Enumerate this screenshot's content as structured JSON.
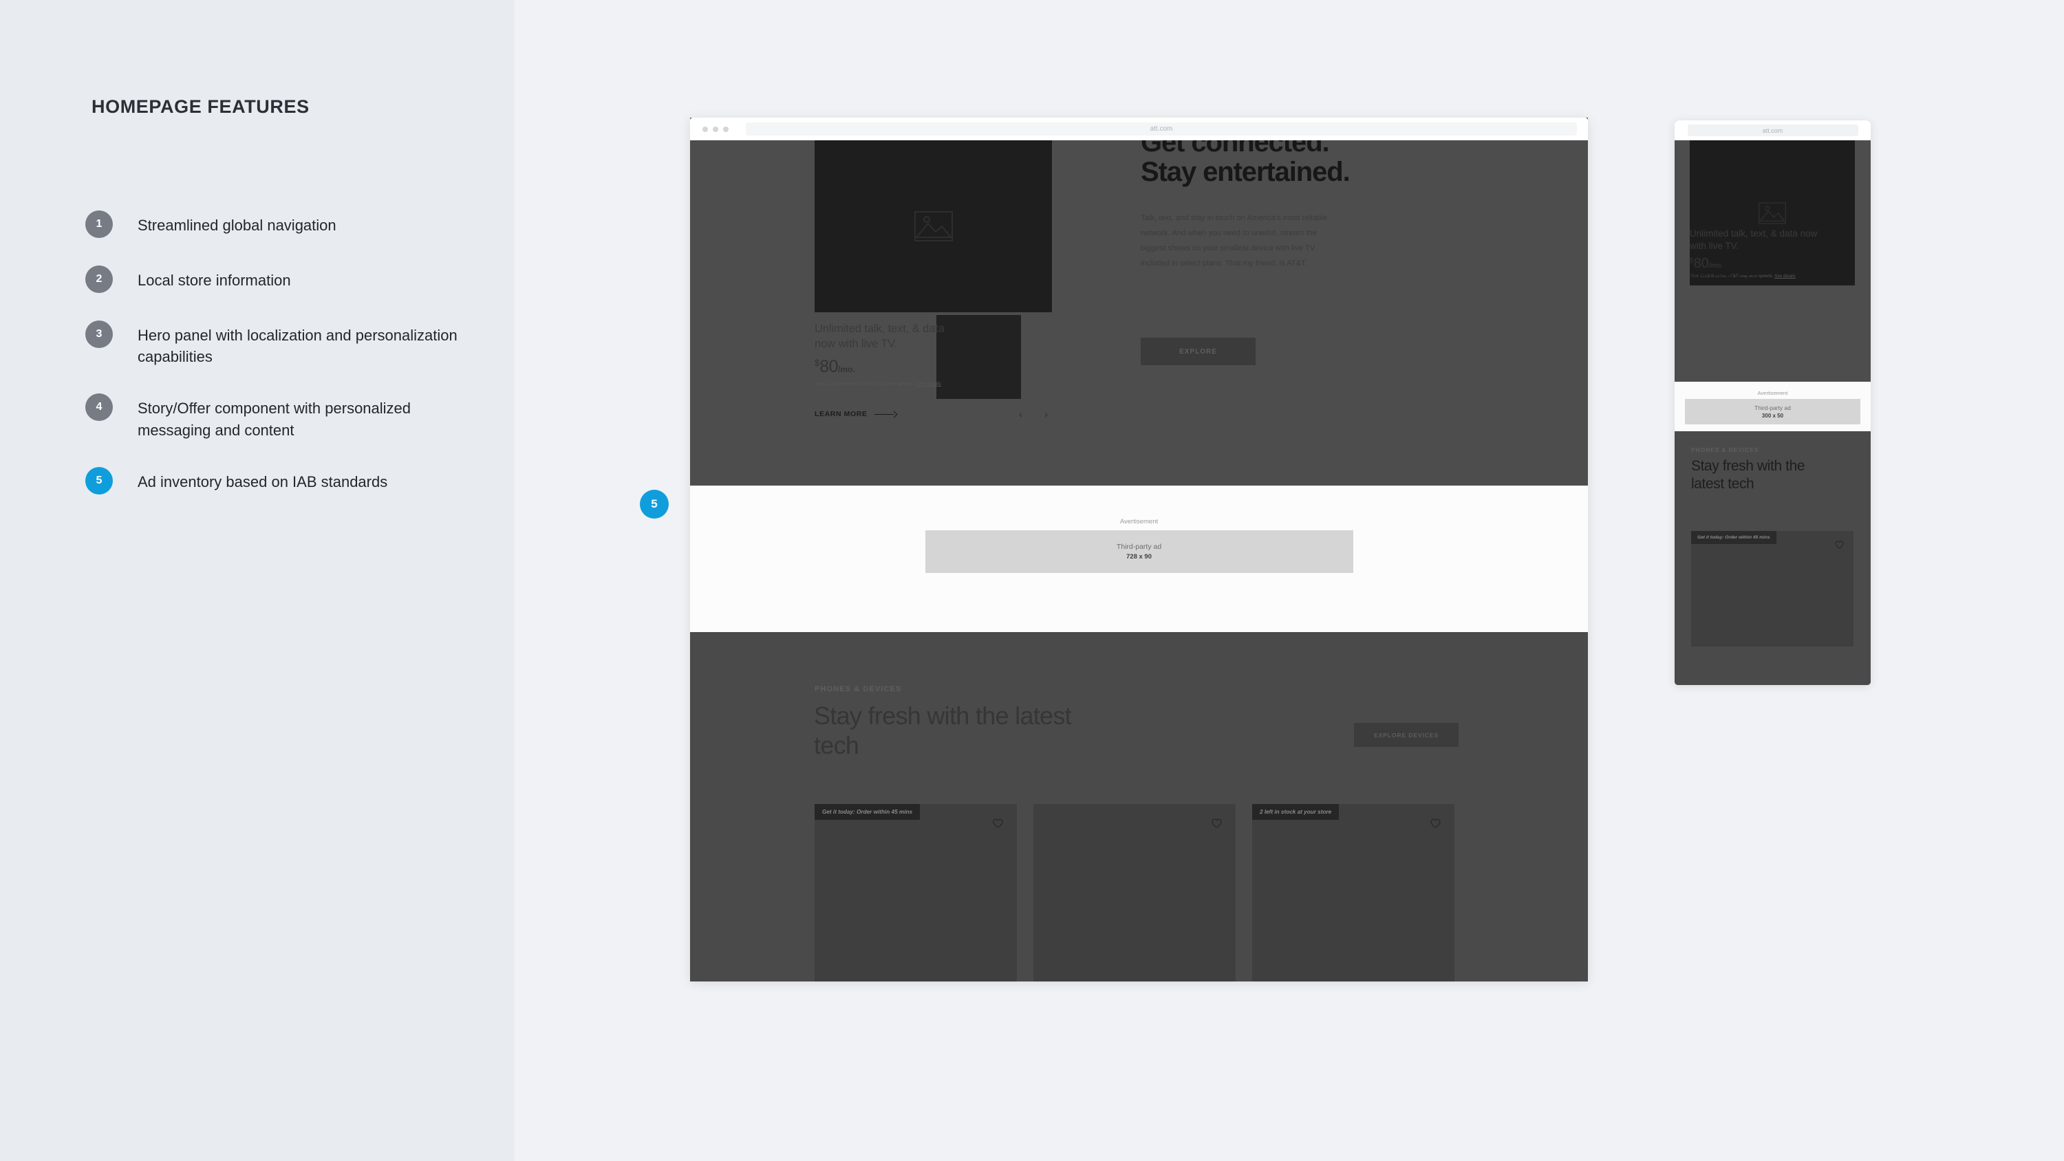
{
  "panel": {
    "title": "HOMEPAGE FEATURES",
    "features": [
      {
        "number": "1",
        "label": "Streamlined global navigation",
        "accent": false
      },
      {
        "number": "2",
        "label": "Local store information",
        "accent": false
      },
      {
        "number": "3",
        "label": "Hero panel with  localization and personalization capabilities",
        "accent": false
      },
      {
        "number": "4",
        "label": "Story/Offer component with personalized messaging and content",
        "accent": false
      },
      {
        "number": "5",
        "label": "Ad inventory based on IAB standards",
        "accent": true
      }
    ]
  },
  "callout": {
    "number": "5"
  },
  "colors": {
    "accent": "#0f9edb",
    "badge_gray": "#767b84",
    "panel_bg": "#e8ebef",
    "stage_bg": "#f0f2f6"
  },
  "desktop": {
    "browser": {
      "url": "att.com"
    },
    "hero": {
      "heading_line1": "Get connected.",
      "heading_line2": "Stay entertained.",
      "body": "Talk, text, and stay in touch on America’s most reliable network. And when you need to unwind, stream the biggest shows on your smallest device with live TV included in select plans. That my friend, is AT&T.",
      "cta": "EXPLORE",
      "offer": {
        "headline": "Unlimited talk, text, & data now with live TV.",
        "price_currency": "$",
        "price_amount": "80",
        "price_period": "/mo.",
        "fineprint": "After 22GB/line/mo. AT&T may slow speeds. ",
        "fineprint_link": "See details",
        "link_label": "LEARN MORE"
      },
      "carousel": {
        "prev": "‹",
        "next": "›"
      }
    },
    "ad": {
      "label": "Avertisement",
      "slot_title": "Third-party ad",
      "slot_size": "728 x 90"
    },
    "devices": {
      "eyebrow": "PHONES & DEVICES",
      "heading": "Stay fresh with the latest tech",
      "cta": "EXPLORE DEVICES",
      "cards": [
        {
          "badge": "Get it today: Order within 45 mins"
        },
        {
          "badge": ""
        },
        {
          "badge": "2 left in stock at your store"
        }
      ]
    }
  },
  "mobile": {
    "browser": {
      "url": "att.com"
    },
    "hero": {
      "offer": {
        "headline": "Unlimited talk, text, & data now with live TV.",
        "price_currency": "$",
        "price_amount": "80",
        "price_period": "/mo.",
        "fineprint": "After 22GB/line/mo. AT&T may slow speeds. ",
        "fineprint_link": "See details",
        "link_label": "LEARN MORE"
      }
    },
    "ad": {
      "label": "Avertisement",
      "slot_title": "Third-party ad",
      "slot_size": "300 x 50"
    },
    "devices": {
      "eyebrow": "PHONES & DEVICES",
      "heading": "Stay fresh with the latest tech",
      "card_badge": "Get it today: Order within 45 mins"
    }
  }
}
